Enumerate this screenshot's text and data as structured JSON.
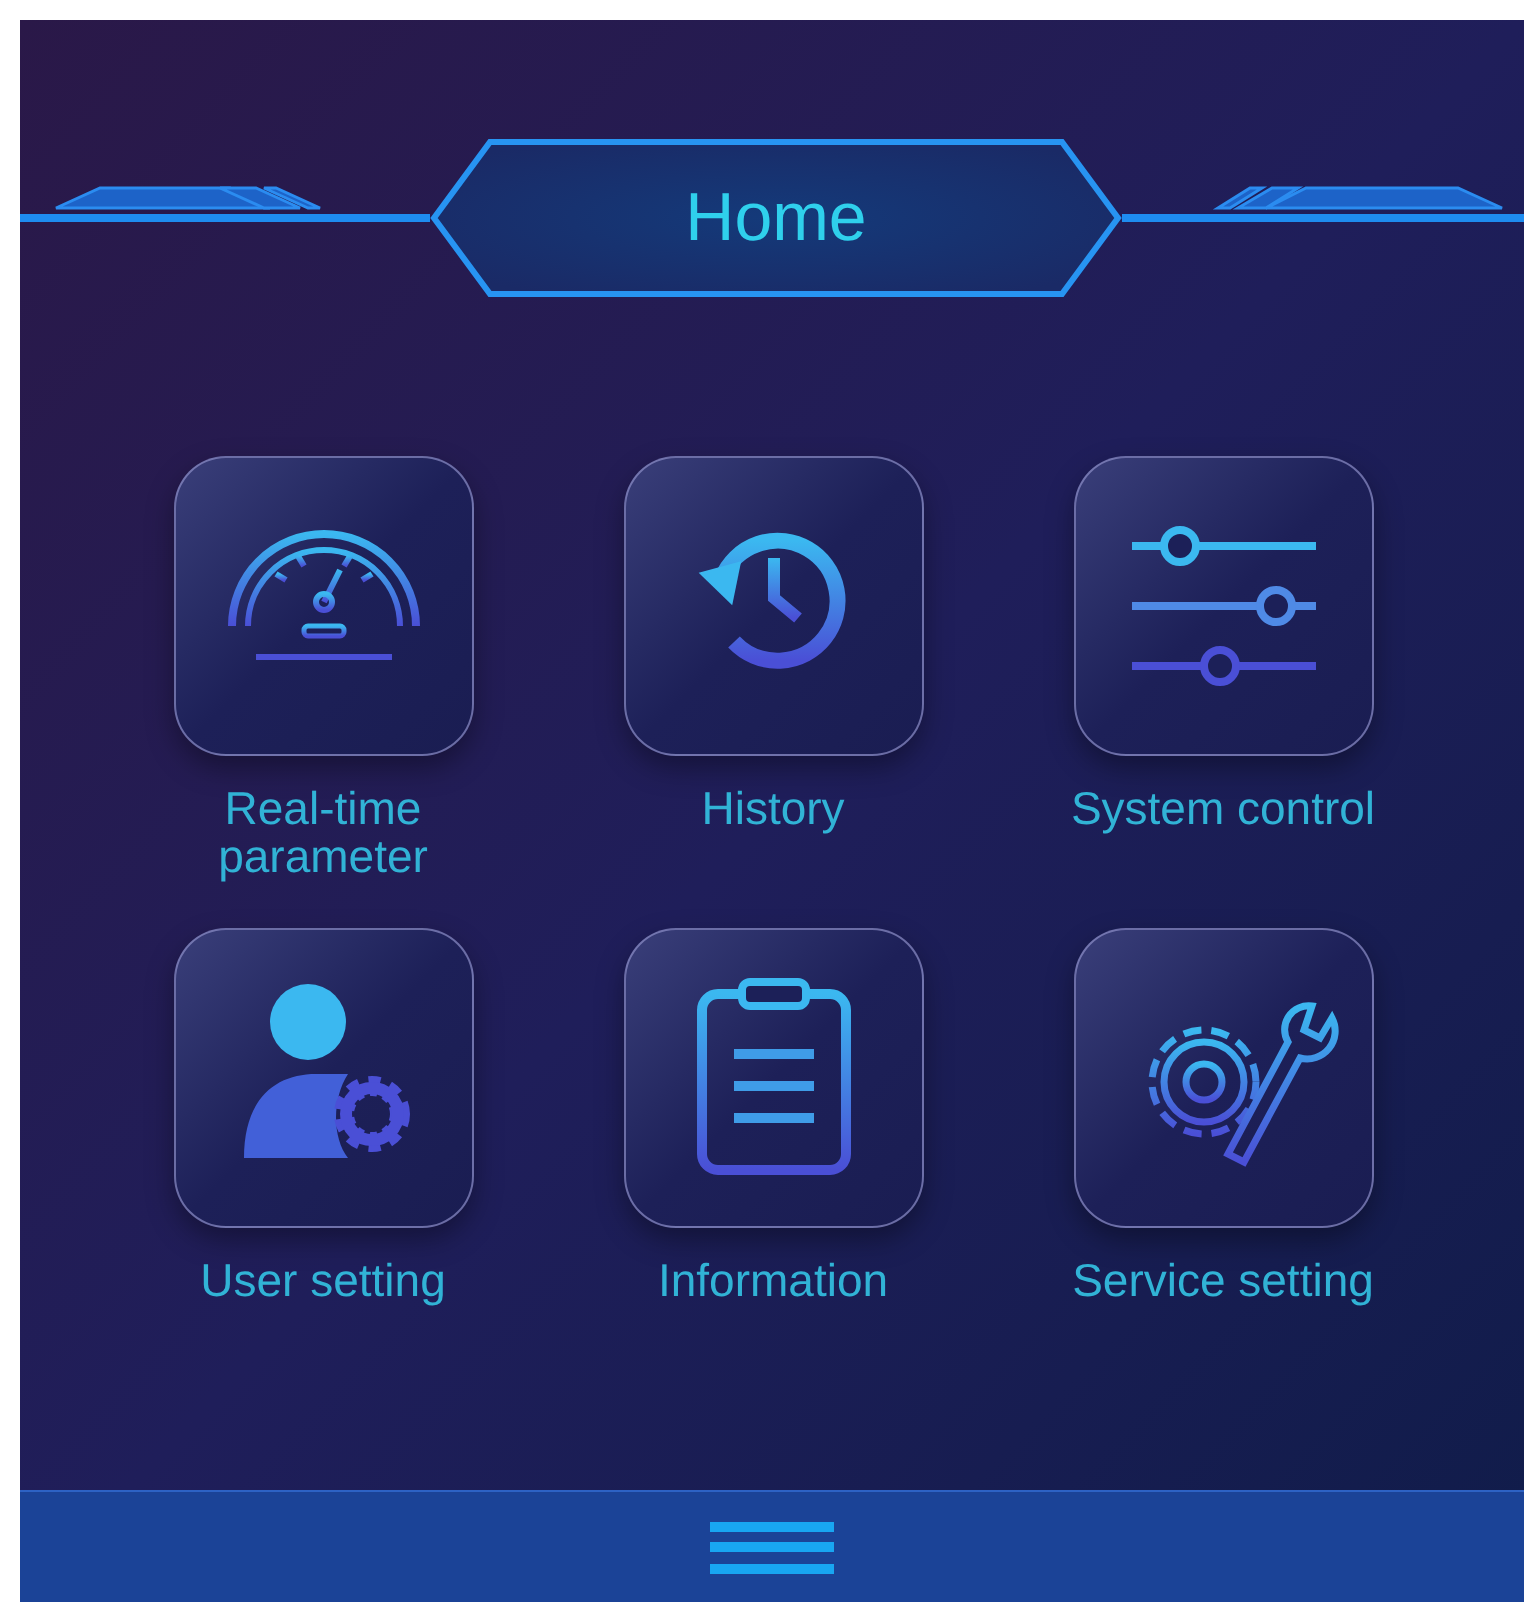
{
  "header": {
    "title": "Home"
  },
  "tiles": [
    {
      "kind": "gauge",
      "label": "Real-time parameter"
    },
    {
      "kind": "history",
      "label": "History"
    },
    {
      "kind": "sliders",
      "label": "System control"
    },
    {
      "kind": "user",
      "label": "User setting"
    },
    {
      "kind": "clipboard",
      "label": "Information"
    },
    {
      "kind": "service",
      "label": "Service setting"
    }
  ]
}
